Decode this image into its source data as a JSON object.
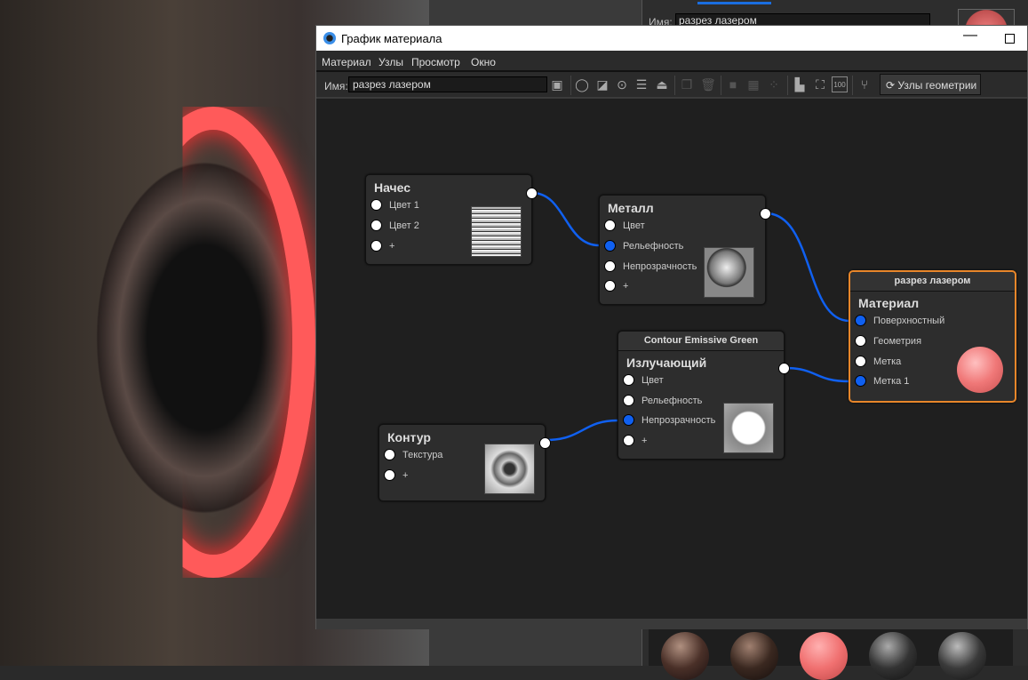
{
  "window": {
    "title": "График материала",
    "minimize": "—"
  },
  "menu": [
    "Материал",
    "Узлы",
    "Просмотр",
    "Окно"
  ],
  "toolbar": {
    "name_label": "Имя:",
    "name_value": "разрез лазером",
    "geometry_nodes": "Узлы геометрии",
    "hundred": "100"
  },
  "right_panel": {
    "name_label": "Имя:",
    "name_value": "разрез лазером"
  },
  "nodes": {
    "nachos": {
      "title": "Начес",
      "rows": [
        "Цвет 1",
        "Цвет 2",
        "+"
      ]
    },
    "metal": {
      "title": "Металл",
      "rows": [
        "Цвет",
        "Рельефность",
        "Непрозрачность",
        "+"
      ]
    },
    "material": {
      "header": "разрез лазером",
      "title": "Материал",
      "rows": [
        "Поверхностный",
        "Геометрия",
        "Метка",
        "Метка 1"
      ]
    },
    "emissive": {
      "header": "Contour Emissive Green",
      "title": "Излучающий",
      "rows": [
        "Цвет",
        "Рельефность",
        "Непрозрачность",
        "+"
      ]
    },
    "contour": {
      "title": "Контур",
      "rows": [
        "Текстура",
        "+"
      ]
    }
  },
  "colors": {
    "wire": "#1060f0",
    "selected": "#e8862a"
  }
}
